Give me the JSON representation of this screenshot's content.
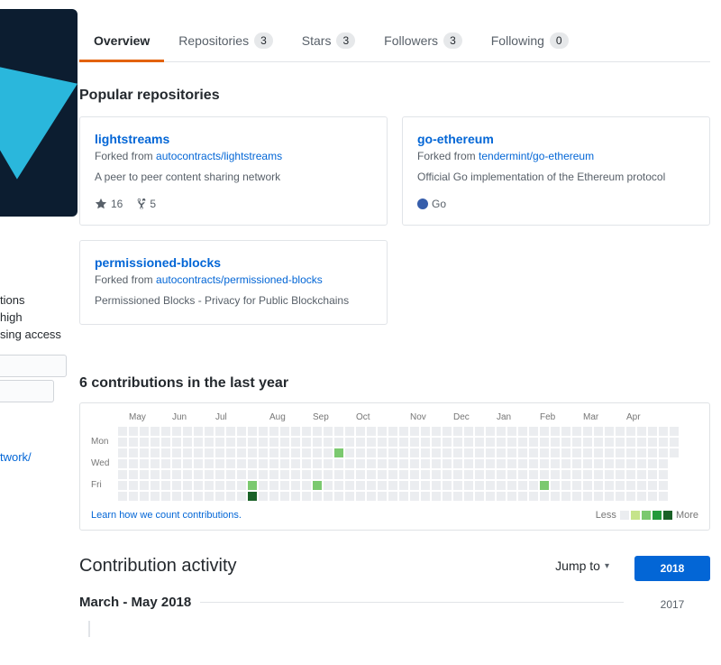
{
  "profile_tabs": {
    "items": [
      {
        "label": "Overview",
        "count": "",
        "active": true
      },
      {
        "label": "Repositories",
        "count": "3",
        "active": false
      },
      {
        "label": "Stars",
        "count": "3",
        "active": false
      },
      {
        "label": "Followers",
        "count": "3",
        "active": false
      },
      {
        "label": "Following",
        "count": "0",
        "active": false
      }
    ]
  },
  "sidebar": {
    "bio_fragments": [
      "tions",
      "high",
      "sing access"
    ],
    "link_fragment": "twork/"
  },
  "popular_repositories": {
    "heading": "Popular repositories",
    "repos": [
      {
        "name": "lightstreams",
        "forked_prefix": "Forked from",
        "forked_from": "autocontracts/lightstreams",
        "description": "A peer to peer content sharing network",
        "stars": "16",
        "forks": "5",
        "language": "",
        "language_color": ""
      },
      {
        "name": "go-ethereum",
        "forked_prefix": "Forked from",
        "forked_from": "tendermint/go-ethereum",
        "description": "Official Go implementation of the Ethereum protocol",
        "stars": "",
        "forks": "",
        "language": "Go",
        "language_color": "#375eab"
      },
      {
        "name": "permissioned-blocks",
        "forked_prefix": "Forked from",
        "forked_from": "autocontracts/permissioned-blocks",
        "description": "Permissioned Blocks - Privacy for Public Blockchains",
        "stars": "",
        "forks": "",
        "language": "",
        "language_color": ""
      }
    ]
  },
  "contributions": {
    "heading": "6 contributions in the last year",
    "months": [
      "May",
      "Jun",
      "Jul",
      "Aug",
      "Sep",
      "Oct",
      "Nov",
      "Dec",
      "Jan",
      "Feb",
      "Mar",
      "Apr"
    ],
    "day_labels": [
      "Mon",
      "Wed",
      "Fri"
    ],
    "weeks": 52,
    "cells": [
      {
        "week": 12,
        "day": 5,
        "level": 2
      },
      {
        "week": 12,
        "day": 6,
        "level": 4
      },
      {
        "week": 18,
        "day": 5,
        "level": 2
      },
      {
        "week": 20,
        "day": 2,
        "level": 2
      },
      {
        "week": 39,
        "day": 5,
        "level": 2
      }
    ],
    "level_colors": [
      "#ebedf0",
      "#c6e48b",
      "#7bc96f",
      "#239a3b",
      "#196127"
    ],
    "learn_link": "Learn how we count contributions.",
    "legend": {
      "less": "Less",
      "more": "More"
    }
  },
  "activity": {
    "heading": "Contribution activity",
    "jump_to": "Jump to",
    "period": "March - May 2018",
    "years": [
      {
        "label": "2018",
        "active": true
      },
      {
        "label": "2017",
        "active": false
      }
    ]
  },
  "colors": {
    "active_tab_underline": "#e36209",
    "link": "#0366d6",
    "selected_year_bg": "#0366d6",
    "avatar_bg": "#0c1d30",
    "avatar_logo": "#2ab7dc"
  }
}
